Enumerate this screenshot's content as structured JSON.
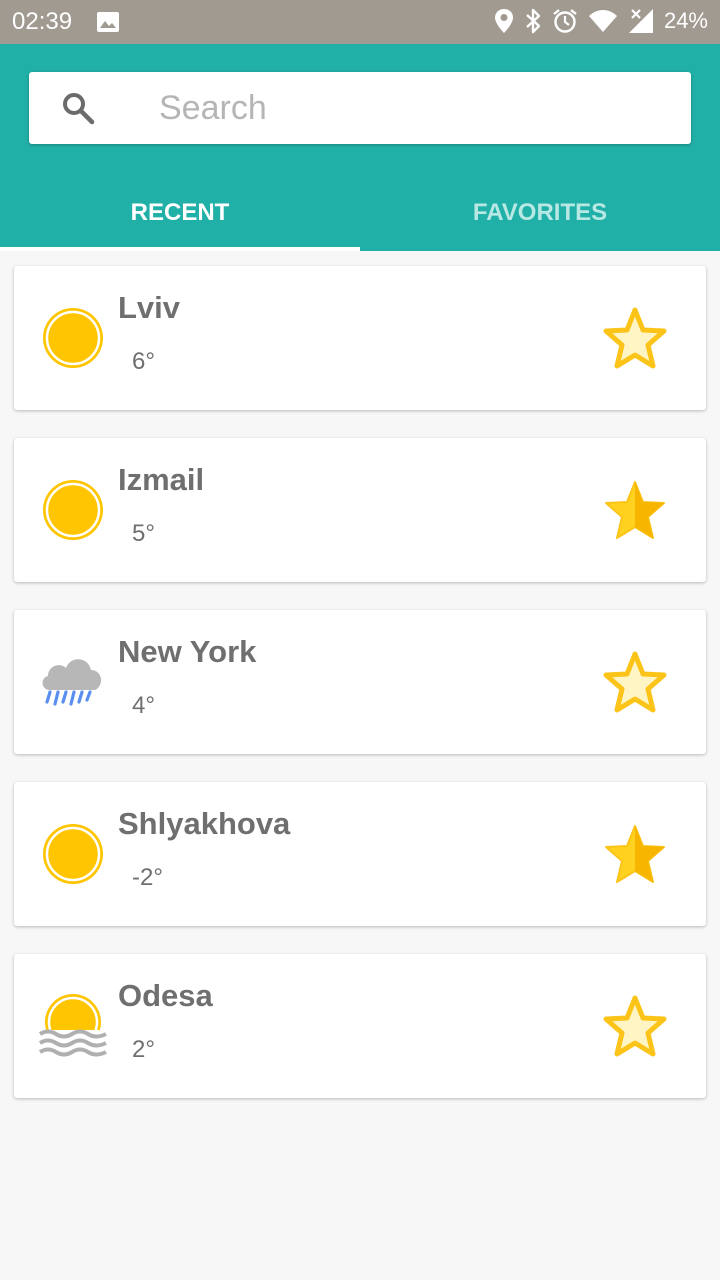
{
  "status_bar": {
    "time": "02:39",
    "battery": "24%"
  },
  "search": {
    "placeholder": "Search",
    "value": ""
  },
  "tabs": [
    {
      "label": "RECENT",
      "active": true
    },
    {
      "label": "FAVORITES",
      "active": false
    }
  ],
  "cities": [
    {
      "name": "Lviv",
      "temp": "6°",
      "weather_icon": "sun-icon",
      "favorite": false
    },
    {
      "name": "Izmail",
      "temp": "5°",
      "weather_icon": "sun-icon",
      "favorite": true
    },
    {
      "name": "New York",
      "temp": "4°",
      "weather_icon": "rain-cloud-icon",
      "favorite": false
    },
    {
      "name": "Shlyakhova",
      "temp": "-2°",
      "weather_icon": "sun-icon",
      "favorite": true
    },
    {
      "name": "Odesa",
      "temp": "2°",
      "weather_icon": "sun-haze-icon",
      "favorite": false
    }
  ],
  "colors": {
    "primary": "#20b0a7",
    "status_bar": "#a09a91",
    "star": "#fcc419",
    "sun": "#ffc500"
  }
}
